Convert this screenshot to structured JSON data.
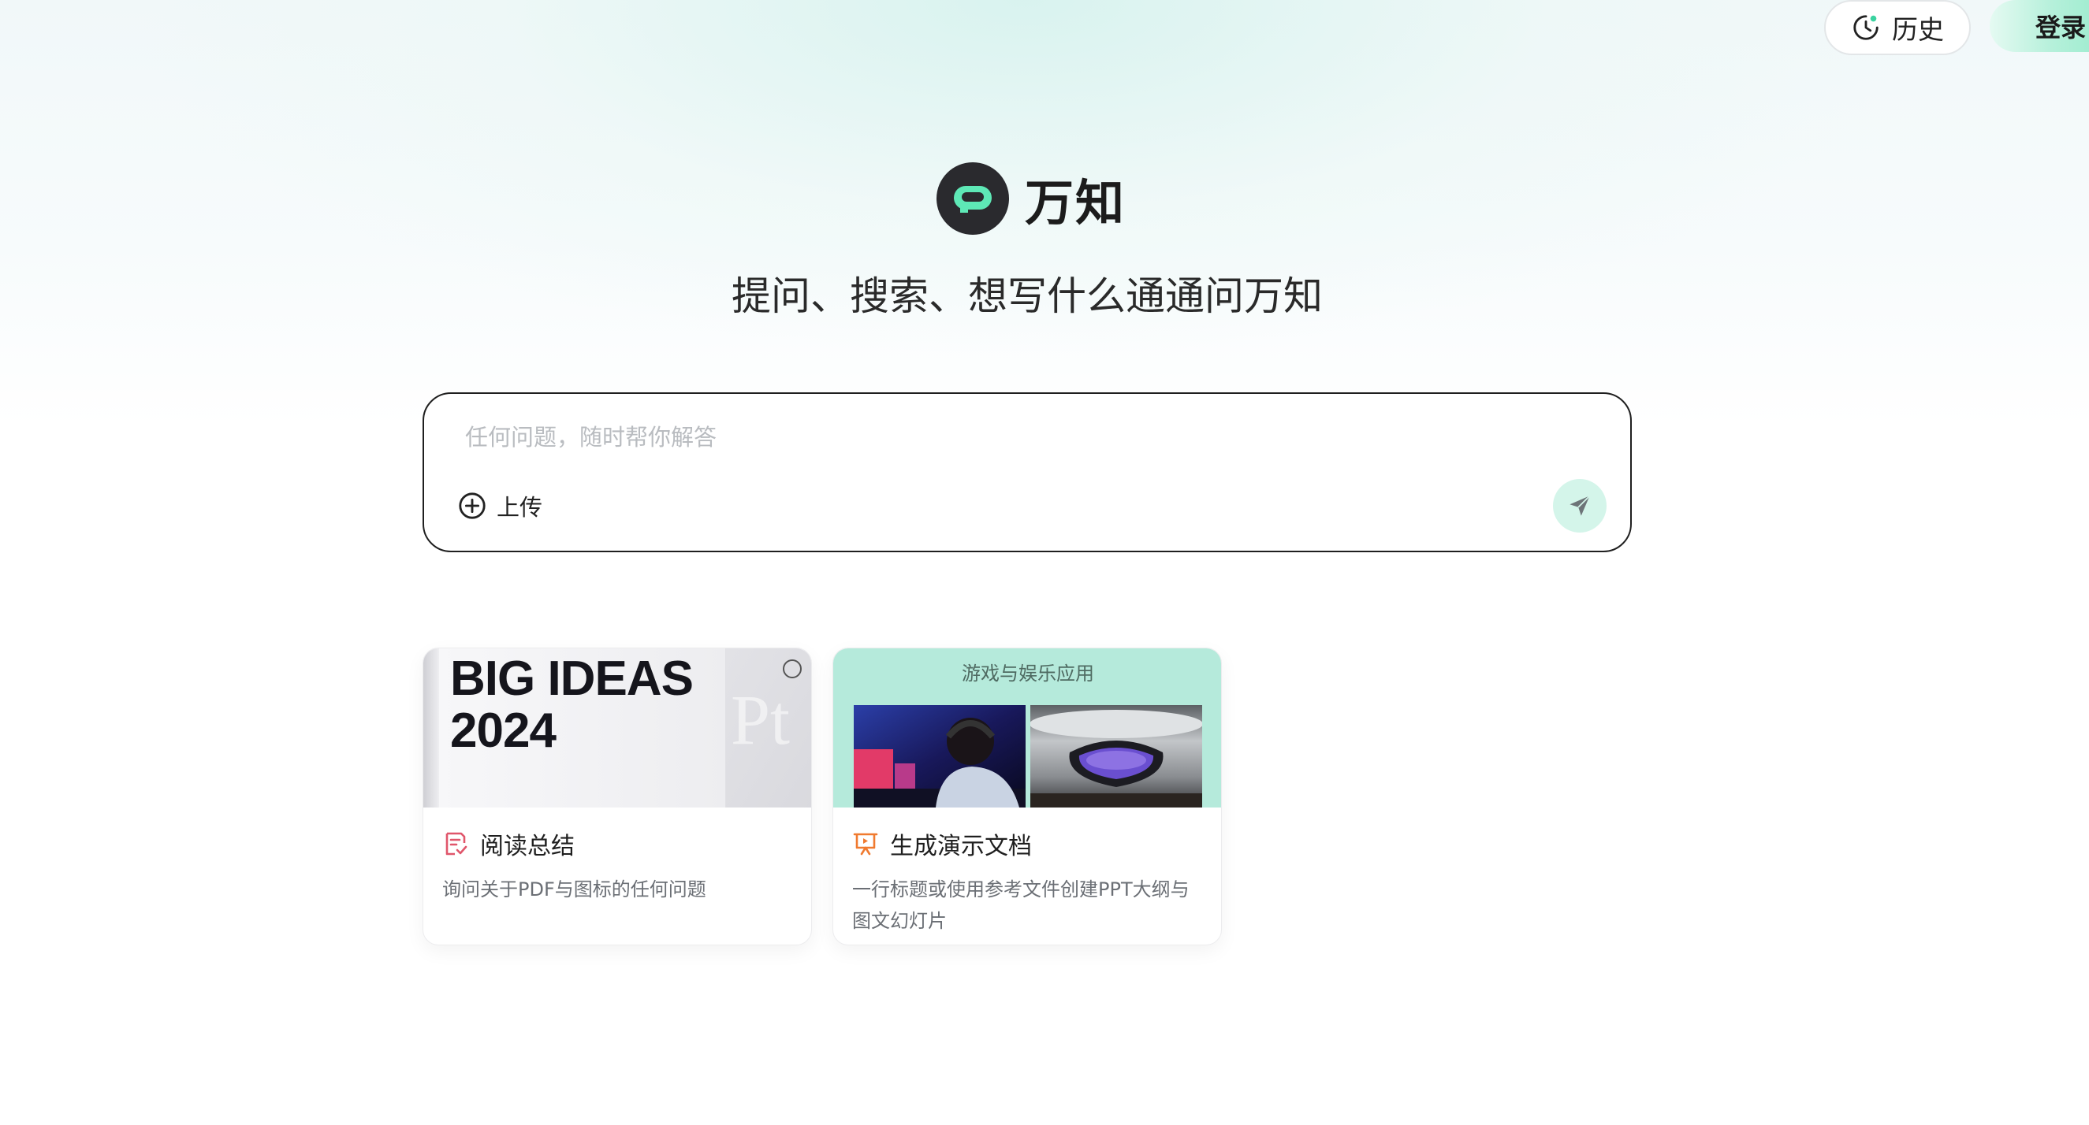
{
  "header": {
    "history_label": "历史",
    "login_label": "登录"
  },
  "brand": {
    "name": "万知",
    "tagline": "提问、搜索、想写什么通通问万知"
  },
  "ask": {
    "placeholder": "任何问题，随时帮你解答",
    "value": "",
    "upload_label": "上传"
  },
  "cards": [
    {
      "image_text": "BIG IDEAS\n2024",
      "title": "阅读总结",
      "description": "询问关于PDF与图标的任何问题"
    },
    {
      "image_label": "游戏与娱乐应用",
      "title": "生成演示文档",
      "description": "一行标题或使用参考文件创建PPT大纲与图文幻灯片"
    }
  ],
  "colors": {
    "accent": "#86e8c4",
    "send_bg": "#d4f5ea",
    "card_banner": "#b5eadb",
    "reading_icon": "#e0566b",
    "ppt_icon": "#f07a2f"
  },
  "icons": {
    "history": "clock-icon",
    "upload": "plus-circle-icon",
    "send": "send-icon",
    "reading": "document-check-icon",
    "ppt": "presentation-icon"
  }
}
